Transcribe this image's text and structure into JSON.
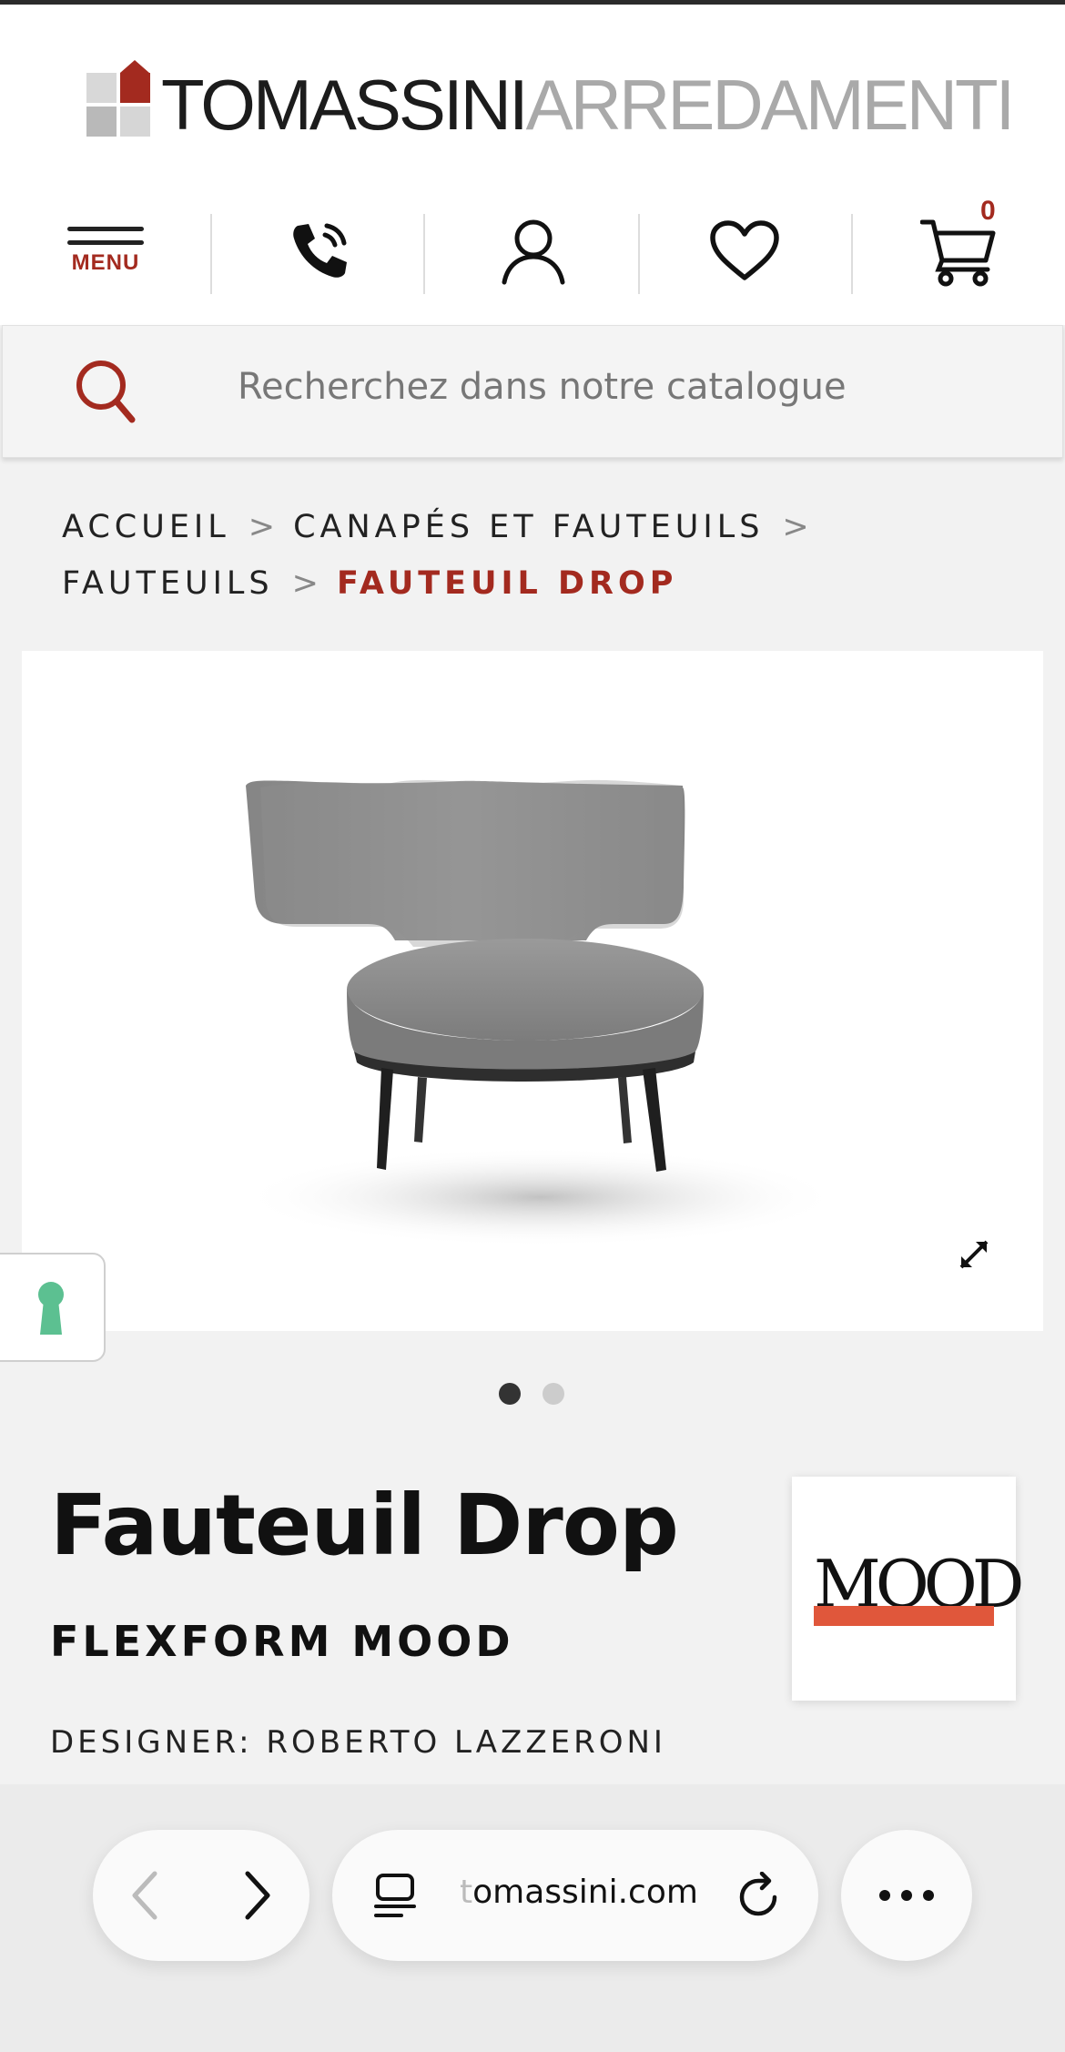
{
  "header": {
    "logo_dark": "TOMASSINI",
    "logo_light": "ARREDAMENTI",
    "menu_label": "MENU",
    "cart_count": "0",
    "icons": [
      "menu-icon",
      "phone-icon",
      "user-icon",
      "heart-icon",
      "cart-icon"
    ]
  },
  "search": {
    "placeholder": "Recherchez dans notre catalogue"
  },
  "breadcrumb": {
    "items": [
      "ACCUEIL",
      "CANAPÉS ET FAUTEUILS",
      "FAUTEUILS"
    ],
    "separator": ">",
    "current": "FAUTEUIL DROP"
  },
  "gallery": {
    "total_slides": 2,
    "active_slide": 1
  },
  "product": {
    "title": "Fauteuil Drop",
    "brand": "FLEXFORM MOOD",
    "designer": "DESIGNER: ROBERTO LAZZERONI",
    "brand_logo_text": "MOOD"
  },
  "browser": {
    "url_faded": "t",
    "url": "omassini.com"
  },
  "colors": {
    "accent": "#a32a1f",
    "lock_icon": "#5cc091"
  }
}
